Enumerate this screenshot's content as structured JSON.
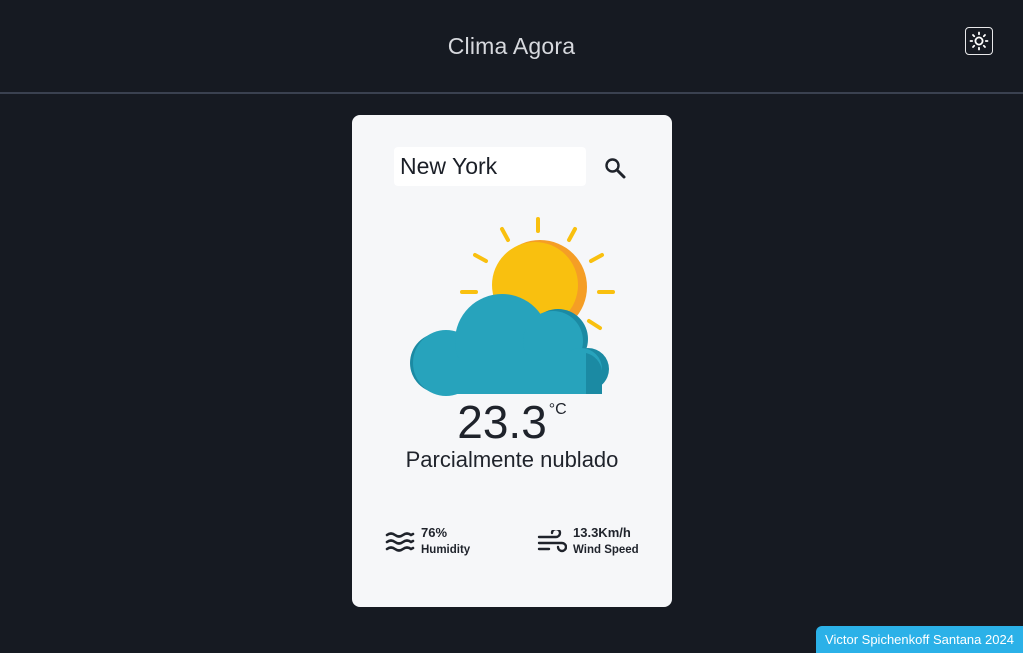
{
  "header": {
    "title": "Clima Agora",
    "theme_toggle_icon": "sun-icon"
  },
  "search": {
    "value": "New York",
    "placeholder": "",
    "button_icon": "search-icon"
  },
  "weather": {
    "icon": "partly-cloudy-icon",
    "temperature": "23.3",
    "unit": "°C",
    "condition": "Parcialmente nublado"
  },
  "details": {
    "humidity": {
      "value": "76%",
      "label": "Humidity",
      "icon": "waves-icon"
    },
    "wind": {
      "value": "13.3Km/h",
      "label": "Wind Speed",
      "icon": "wind-icon"
    }
  },
  "footer": {
    "credit": "Victor Spichenkoff Santana 2024"
  },
  "colors": {
    "background": "#161a22",
    "card": "#f6f7f9",
    "sun": "#f9c00f",
    "sun_shadow": "#f59e25",
    "cloud": "#27a3bc",
    "cloud_shadow": "#1b8aa3",
    "footer": "#2bb1e8"
  }
}
